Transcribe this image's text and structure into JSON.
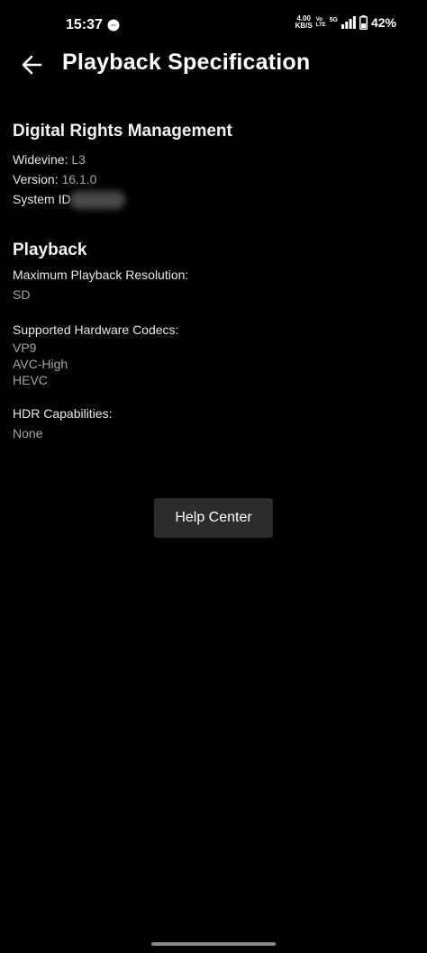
{
  "status_bar": {
    "time": "15:37",
    "net_speed_value": "4.00",
    "net_speed_unit": "KB/S",
    "volte_top": "Vo",
    "volte_bottom": "LTE",
    "fiveg_label": "5G",
    "battery_percent": "42%",
    "icons": [
      "messenger-icon",
      "signal-icon",
      "battery-icon"
    ]
  },
  "header": {
    "back_icon": "arrow-left-icon",
    "title": "Playback Specification"
  },
  "drm": {
    "title": "Digital Rights Management",
    "widevine_label": "Widevine:",
    "widevine_value": "L3",
    "version_label": "Version:",
    "version_value": "16.1.0",
    "system_id_label": "System ID"
  },
  "playback": {
    "title": "Playback",
    "max_res_label": "Maximum Playback Resolution:",
    "max_res_value": "SD",
    "codecs_label": "Supported Hardware Codecs:",
    "codecs": [
      "VP9",
      "AVC-High",
      "HEVC"
    ],
    "hdr_label": "HDR Capabilities:",
    "hdr_value": "None"
  },
  "help_button_label": "Help Center",
  "colors": {
    "background": "#000000",
    "text_primary": "#ffffff",
    "text_secondary": "#a6a6a6",
    "button_bg": "#2c2c2c"
  }
}
